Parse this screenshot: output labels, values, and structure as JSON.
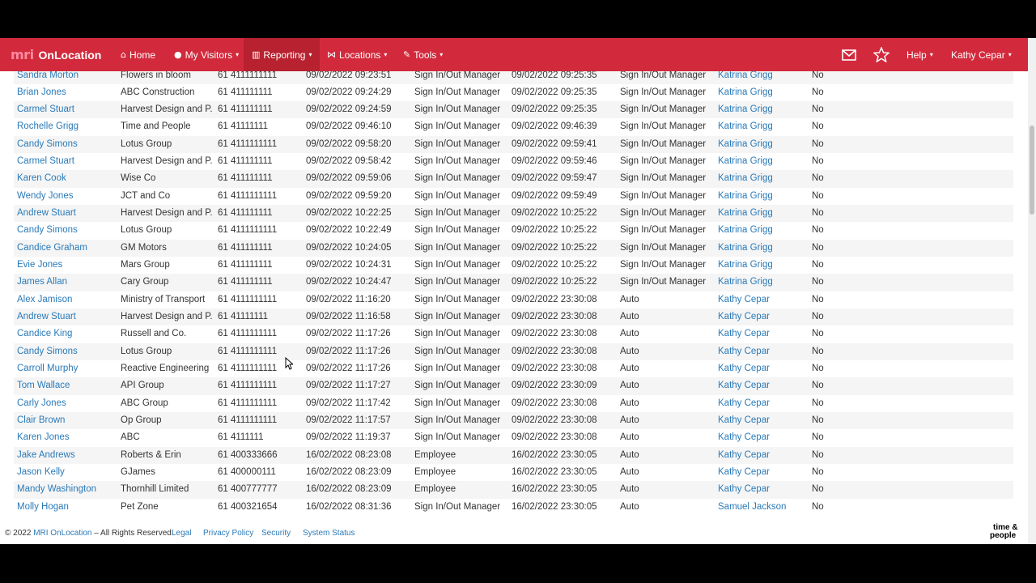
{
  "brand": {
    "logo": "mri",
    "name": "OnLocation"
  },
  "nav": {
    "home": "Home",
    "my_visitors": "My Visitors",
    "reporting": "Reporting",
    "locations": "Locations",
    "tools": "Tools",
    "help": "Help",
    "user": "Kathy Cepar"
  },
  "rows": [
    {
      "name": "Sandra Morton",
      "company": "Flowers in bloom",
      "phone": "61 4111111111",
      "in_time": "09/02/2022 09:23:51",
      "in_by": "Sign In/Out Manager",
      "out_time": "09/02/2022 09:25:35",
      "out_by": "Sign In/Out Manager",
      "host": "Katrina Grigg",
      "flag": "No"
    },
    {
      "name": "Brian Jones",
      "company": "ABC Construction",
      "phone": "61 411111111",
      "in_time": "09/02/2022 09:24:29",
      "in_by": "Sign In/Out Manager",
      "out_time": "09/02/2022 09:25:35",
      "out_by": "Sign In/Out Manager",
      "host": "Katrina Grigg",
      "flag": "No"
    },
    {
      "name": "Carmel Stuart",
      "company": "Harvest Design and P...",
      "phone": "61 411111111",
      "in_time": "09/02/2022 09:24:59",
      "in_by": "Sign In/Out Manager",
      "out_time": "09/02/2022 09:25:35",
      "out_by": "Sign In/Out Manager",
      "host": "Katrina Grigg",
      "flag": "No"
    },
    {
      "name": "Rochelle Grigg",
      "company": "Time and People",
      "phone": "61 41111111",
      "in_time": "09/02/2022 09:46:10",
      "in_by": "Sign In/Out Manager",
      "out_time": "09/02/2022 09:46:39",
      "out_by": "Sign In/Out Manager",
      "host": "Katrina Grigg",
      "flag": "No"
    },
    {
      "name": "Candy Simons",
      "company": "Lotus Group",
      "phone": "61 4111111111",
      "in_time": "09/02/2022 09:58:20",
      "in_by": "Sign In/Out Manager",
      "out_time": "09/02/2022 09:59:41",
      "out_by": "Sign In/Out Manager",
      "host": "Katrina Grigg",
      "flag": "No"
    },
    {
      "name": "Carmel Stuart",
      "company": "Harvest Design and P...",
      "phone": "61 411111111",
      "in_time": "09/02/2022 09:58:42",
      "in_by": "Sign In/Out Manager",
      "out_time": "09/02/2022 09:59:46",
      "out_by": "Sign In/Out Manager",
      "host": "Katrina Grigg",
      "flag": "No"
    },
    {
      "name": "Karen Cook",
      "company": "Wise Co",
      "phone": "61 411111111",
      "in_time": "09/02/2022 09:59:06",
      "in_by": "Sign In/Out Manager",
      "out_time": "09/02/2022 09:59:47",
      "out_by": "Sign In/Out Manager",
      "host": "Katrina Grigg",
      "flag": "No"
    },
    {
      "name": "Wendy Jones",
      "company": "JCT and Co",
      "phone": "61 4111111111",
      "in_time": "09/02/2022 09:59:20",
      "in_by": "Sign In/Out Manager",
      "out_time": "09/02/2022 09:59:49",
      "out_by": "Sign In/Out Manager",
      "host": "Katrina Grigg",
      "flag": "No"
    },
    {
      "name": "Andrew Stuart",
      "company": "Harvest Design and P...",
      "phone": "61 411111111",
      "in_time": "09/02/2022 10:22:25",
      "in_by": "Sign In/Out Manager",
      "out_time": "09/02/2022 10:25:22",
      "out_by": "Sign In/Out Manager",
      "host": "Katrina Grigg",
      "flag": "No"
    },
    {
      "name": "Candy Simons",
      "company": "Lotus Group",
      "phone": "61 4111111111",
      "in_time": "09/02/2022 10:22:49",
      "in_by": "Sign In/Out Manager",
      "out_time": "09/02/2022 10:25:22",
      "out_by": "Sign In/Out Manager",
      "host": "Katrina Grigg",
      "flag": "No"
    },
    {
      "name": "Candice Graham",
      "company": "GM Motors",
      "phone": "61 411111111",
      "in_time": "09/02/2022 10:24:05",
      "in_by": "Sign In/Out Manager",
      "out_time": "09/02/2022 10:25:22",
      "out_by": "Sign In/Out Manager",
      "host": "Katrina Grigg",
      "flag": "No"
    },
    {
      "name": "Evie Jones",
      "company": "Mars Group",
      "phone": "61 411111111",
      "in_time": "09/02/2022 10:24:31",
      "in_by": "Sign In/Out Manager",
      "out_time": "09/02/2022 10:25:22",
      "out_by": "Sign In/Out Manager",
      "host": "Katrina Grigg",
      "flag": "No"
    },
    {
      "name": "James Allan",
      "company": "Cary Group",
      "phone": "61 411111111",
      "in_time": "09/02/2022 10:24:47",
      "in_by": "Sign In/Out Manager",
      "out_time": "09/02/2022 10:25:22",
      "out_by": "Sign In/Out Manager",
      "host": "Katrina Grigg",
      "flag": "No"
    },
    {
      "name": "Alex Jamison",
      "company": "Ministry of Transport",
      "phone": "61 4111111111",
      "in_time": "09/02/2022 11:16:20",
      "in_by": "Sign In/Out Manager",
      "out_time": "09/02/2022 23:30:08",
      "out_by": "Auto",
      "host": "Kathy Cepar",
      "flag": "No"
    },
    {
      "name": "Andrew Stuart",
      "company": "Harvest Design and P...",
      "phone": "61 41111111",
      "in_time": "09/02/2022 11:16:58",
      "in_by": "Sign In/Out Manager",
      "out_time": "09/02/2022 23:30:08",
      "out_by": "Auto",
      "host": "Kathy Cepar",
      "flag": "No"
    },
    {
      "name": "Candice King",
      "company": "Russell and Co.",
      "phone": "61 4111111111",
      "in_time": "09/02/2022 11:17:26",
      "in_by": "Sign In/Out Manager",
      "out_time": "09/02/2022 23:30:08",
      "out_by": "Auto",
      "host": "Kathy Cepar",
      "flag": "No"
    },
    {
      "name": "Candy Simons",
      "company": "Lotus Group",
      "phone": "61 4111111111",
      "in_time": "09/02/2022 11:17:26",
      "in_by": "Sign In/Out Manager",
      "out_time": "09/02/2022 23:30:08",
      "out_by": "Auto",
      "host": "Kathy Cepar",
      "flag": "No"
    },
    {
      "name": "Carroll Murphy",
      "company": "Reactive Engineering",
      "phone": "61 4111111111",
      "in_time": "09/02/2022 11:17:26",
      "in_by": "Sign In/Out Manager",
      "out_time": "09/02/2022 23:30:08",
      "out_by": "Auto",
      "host": "Kathy Cepar",
      "flag": "No"
    },
    {
      "name": "Tom Wallace",
      "company": "API Group",
      "phone": "61 4111111111",
      "in_time": "09/02/2022 11:17:27",
      "in_by": "Sign In/Out Manager",
      "out_time": "09/02/2022 23:30:09",
      "out_by": "Auto",
      "host": "Kathy Cepar",
      "flag": "No"
    },
    {
      "name": "Carly Jones",
      "company": "ABC Group",
      "phone": "61 4111111111",
      "in_time": "09/02/2022 11:17:42",
      "in_by": "Sign In/Out Manager",
      "out_time": "09/02/2022 23:30:08",
      "out_by": "Auto",
      "host": "Kathy Cepar",
      "flag": "No"
    },
    {
      "name": "Clair Brown",
      "company": "Op Group",
      "phone": "61 4111111111",
      "in_time": "09/02/2022 11:17:57",
      "in_by": "Sign In/Out Manager",
      "out_time": "09/02/2022 23:30:08",
      "out_by": "Auto",
      "host": "Kathy Cepar",
      "flag": "No"
    },
    {
      "name": "Karen Jones",
      "company": "ABC",
      "phone": "61 4111111",
      "in_time": "09/02/2022 11:19:37",
      "in_by": "Sign In/Out Manager",
      "out_time": "09/02/2022 23:30:08",
      "out_by": "Auto",
      "host": "Kathy Cepar",
      "flag": "No"
    },
    {
      "name": "Jake Andrews",
      "company": "Roberts & Erin",
      "phone": "61 400333666",
      "in_time": "16/02/2022 08:23:08",
      "in_by": "Employee",
      "out_time": "16/02/2022 23:30:05",
      "out_by": "Auto",
      "host": "Kathy Cepar",
      "flag": "No"
    },
    {
      "name": "Jason Kelly",
      "company": "GJames",
      "phone": "61 400000111",
      "in_time": "16/02/2022 08:23:09",
      "in_by": "Employee",
      "out_time": "16/02/2022 23:30:05",
      "out_by": "Auto",
      "host": "Kathy Cepar",
      "flag": "No"
    },
    {
      "name": "Mandy Washington",
      "company": "Thornhill Limited",
      "phone": "61 400777777",
      "in_time": "16/02/2022 08:23:09",
      "in_by": "Employee",
      "out_time": "16/02/2022 23:30:05",
      "out_by": "Auto",
      "host": "Kathy Cepar",
      "flag": "No"
    },
    {
      "name": "Molly Hogan",
      "company": "Pet Zone",
      "phone": "61 400321654",
      "in_time": "16/02/2022 08:31:36",
      "in_by": "Sign In/Out Manager",
      "out_time": "16/02/2022 23:30:05",
      "out_by": "Auto",
      "host": "Samuel Jackson",
      "flag": "No"
    }
  ],
  "footer": {
    "copyright_prefix": "© 2022",
    "copyright_link": "MRI OnLocation",
    "copyright_suffix": "– All Rights Reserved.",
    "legal": "Legal",
    "privacy": "Privacy Policy",
    "security": "Security",
    "system_status": "System Status",
    "logo_line1": "time &",
    "logo_line2": "people"
  },
  "colors": {
    "nav_bg": "#d22a3c",
    "link": "#2a7ab8"
  }
}
